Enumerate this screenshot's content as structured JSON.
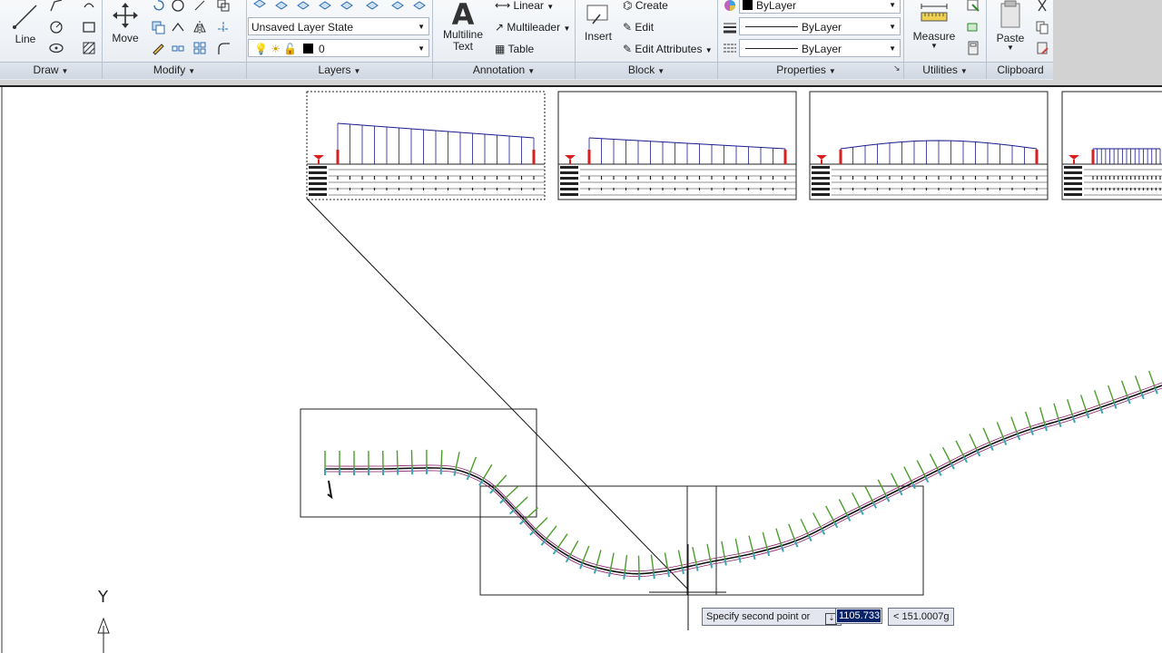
{
  "ribbon": {
    "draw": {
      "title": "Draw",
      "line_label": "Line"
    },
    "modify": {
      "title": "Modify",
      "move_label": "Move"
    },
    "layers": {
      "title": "Layers",
      "layer_state": "Unsaved Layer State",
      "current_layer": "0"
    },
    "annotation": {
      "title": "Annotation",
      "multiline_text_label_1": "Multiline",
      "multiline_text_label_2": "Text",
      "linear_label": "Linear",
      "multileader_label": "Multileader",
      "table_label": "Table"
    },
    "block": {
      "title": "Block",
      "insert_label": "Insert",
      "create_label": "Create",
      "edit_label": "Edit",
      "edit_attributes_label": "Edit Attributes"
    },
    "properties": {
      "title": "Properties",
      "color": "ByLayer",
      "linetype": "ByLayer",
      "lineweight": "ByLayer"
    },
    "utilities": {
      "title": "Utilities",
      "measure_label": "Measure"
    },
    "clipboard": {
      "title": "Clipboard",
      "paste_label": "Paste"
    }
  },
  "command_tip": {
    "prompt": "Specify second point or",
    "distance_value": "1105.733",
    "angle_value": "< 151.0007g"
  },
  "ucs": {
    "y_label": "Y"
  },
  "colors": {
    "ribbon_bg": "#e6ebf1",
    "profile_blue": "#1b1b8f",
    "marker_red": "#d81e1e",
    "tick_green": "#4a9e2a",
    "tick_cyan": "#3aa6b3"
  }
}
